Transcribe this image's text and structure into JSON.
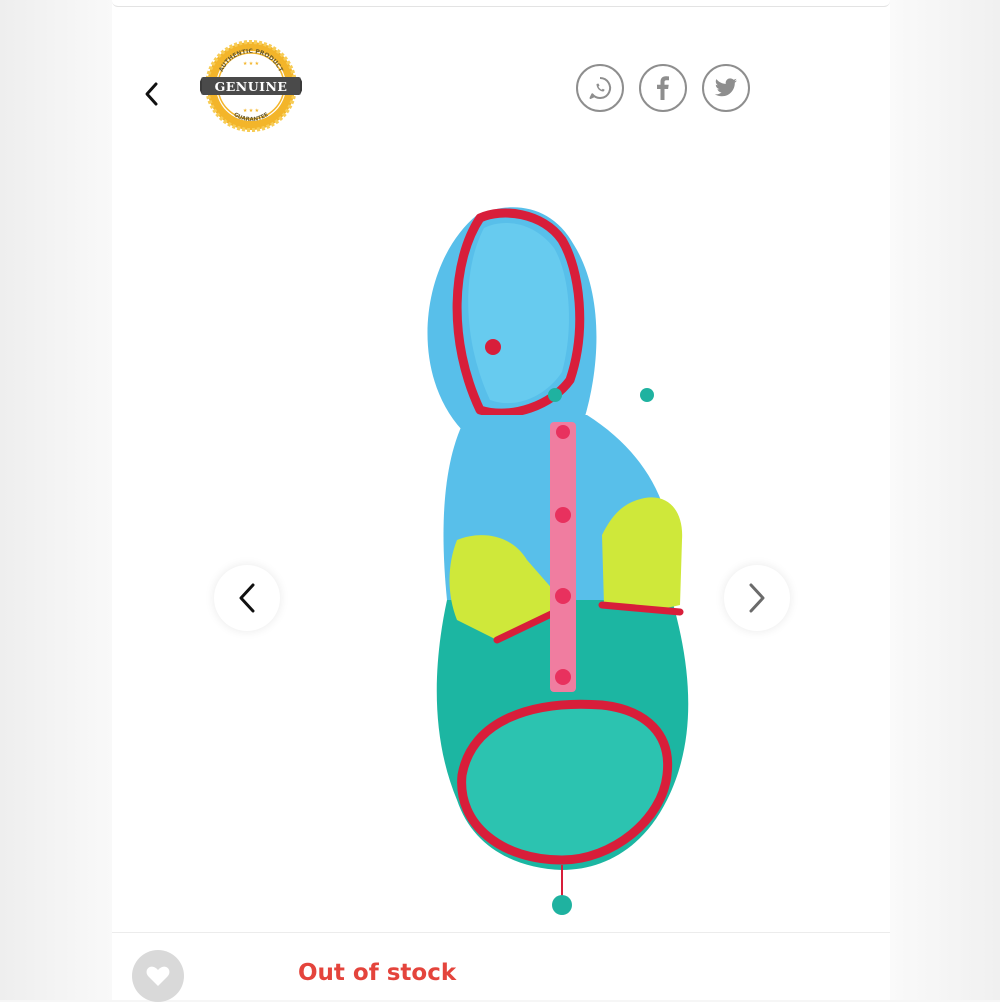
{
  "badge": {
    "arc_top": "AUTHENTIC PRODUCT",
    "ribbon": "GENUINE",
    "arc_bottom": "GUARANTEE",
    "gold": "#f3b52a",
    "ribbon_color": "#4a4a4a"
  },
  "header": {
    "back_icon": "chevron-left-icon",
    "share_icons": [
      "whatsapp-icon",
      "facebook-icon",
      "twitter-icon"
    ]
  },
  "gallery": {
    "prev_icon": "chevron-left-icon",
    "next_icon": "chevron-right-icon",
    "image": "dog-raincoat-photo"
  },
  "product": {
    "stock_status": "Out of stock",
    "status_color": "#e4443c"
  },
  "colors": {
    "raincoat_blue": "#5cc3ee",
    "raincoat_teal": "#1db7a3",
    "raincoat_lime": "#cfe83a",
    "trim_red": "#e0213f",
    "placket_pink": "#f07da0"
  }
}
